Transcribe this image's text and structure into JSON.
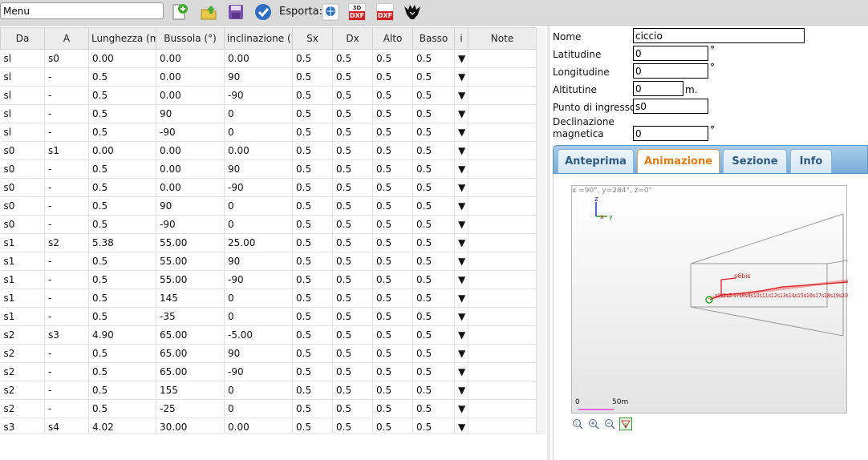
{
  "toolbar": {
    "menu_value": "Menu",
    "export_label": "Esporta:",
    "icons": [
      "new-file-icon",
      "open-folder-icon",
      "save-disk-icon",
      "check-icon",
      "kml-globe-icon",
      "dxf-3d-icon",
      "dxf-icon",
      "therion-bat-icon"
    ],
    "dxf3d_top": "3D",
    "dxf_label": "DXF"
  },
  "grid": {
    "columns": [
      "Da",
      "A",
      "Lunghezza (m)",
      "Bussola (°)",
      "inclinazione (°)",
      "Sx",
      "Dx",
      "Alto",
      "Basso",
      "i",
      "Note"
    ],
    "rows": [
      [
        "sl",
        "s0",
        "0.00",
        "0.00",
        "0.00",
        "0.5",
        "0.5",
        "0.5",
        "0.5",
        "▼",
        ""
      ],
      [
        "sl",
        "-",
        "0.5",
        "0.00",
        "90",
        "0.5",
        "0.5",
        "0.5",
        "0.5",
        "▼",
        ""
      ],
      [
        "sl",
        "-",
        "0.5",
        "0.00",
        "-90",
        "0.5",
        "0.5",
        "0.5",
        "0.5",
        "▼",
        ""
      ],
      [
        "sl",
        "-",
        "0.5",
        "90",
        "0",
        "0.5",
        "0.5",
        "0.5",
        "0.5",
        "▼",
        ""
      ],
      [
        "sl",
        "-",
        "0.5",
        "-90",
        "0",
        "0.5",
        "0.5",
        "0.5",
        "0.5",
        "▼",
        ""
      ],
      [
        "s0",
        "s1",
        "0.00",
        "0.00",
        "0.00",
        "0.5",
        "0.5",
        "0.5",
        "0.5",
        "▼",
        ""
      ],
      [
        "s0",
        "-",
        "0.5",
        "0.00",
        "90",
        "0.5",
        "0.5",
        "0.5",
        "0.5",
        "▼",
        ""
      ],
      [
        "s0",
        "-",
        "0.5",
        "0.00",
        "-90",
        "0.5",
        "0.5",
        "0.5",
        "0.5",
        "▼",
        ""
      ],
      [
        "s0",
        "-",
        "0.5",
        "90",
        "0",
        "0.5",
        "0.5",
        "0.5",
        "0.5",
        "▼",
        ""
      ],
      [
        "s0",
        "-",
        "0.5",
        "-90",
        "0",
        "0.5",
        "0.5",
        "0.5",
        "0.5",
        "▼",
        ""
      ],
      [
        "s1",
        "s2",
        "5.38",
        "55.00",
        "25.00",
        "0.5",
        "0.5",
        "0.5",
        "0.5",
        "▼",
        ""
      ],
      [
        "s1",
        "-",
        "0.5",
        "55.00",
        "90",
        "0.5",
        "0.5",
        "0.5",
        "0.5",
        "▼",
        ""
      ],
      [
        "s1",
        "-",
        "0.5",
        "55.00",
        "-90",
        "0.5",
        "0.5",
        "0.5",
        "0.5",
        "▼",
        ""
      ],
      [
        "s1",
        "-",
        "0.5",
        "145",
        "0",
        "0.5",
        "0.5",
        "0.5",
        "0.5",
        "▼",
        ""
      ],
      [
        "s1",
        "-",
        "0.5",
        "-35",
        "0",
        "0.5",
        "0.5",
        "0.5",
        "0.5",
        "▼",
        ""
      ],
      [
        "s2",
        "s3",
        "4.90",
        "65.00",
        "-5.00",
        "0.5",
        "0.5",
        "0.5",
        "0.5",
        "▼",
        ""
      ],
      [
        "s2",
        "-",
        "0.5",
        "65.00",
        "90",
        "0.5",
        "0.5",
        "0.5",
        "0.5",
        "▼",
        ""
      ],
      [
        "s2",
        "-",
        "0.5",
        "65.00",
        "-90",
        "0.5",
        "0.5",
        "0.5",
        "0.5",
        "▼",
        ""
      ],
      [
        "s2",
        "-",
        "0.5",
        "155",
        "0",
        "0.5",
        "0.5",
        "0.5",
        "0.5",
        "▼",
        ""
      ],
      [
        "s2",
        "-",
        "0.5",
        "-25",
        "0",
        "0.5",
        "0.5",
        "0.5",
        "0.5",
        "▼",
        ""
      ],
      [
        "s3",
        "s4",
        "4.02",
        "30.00",
        "0.00",
        "0.5",
        "0.5",
        "0.5",
        "0.5",
        "▼",
        ""
      ]
    ]
  },
  "props": {
    "name_label": "Nome",
    "name_value": "ciccio",
    "lat_label": "Latitudine",
    "lat_value": "0",
    "lon_label": "Longitudine",
    "lon_value": "0",
    "alt_label": "Altitutine",
    "alt_value": "0",
    "alt_unit": "m.",
    "entry_label": "Punto di ingresso",
    "entry_value": "s0",
    "decl_label_1": "Declinazione",
    "decl_label_2": "magnetica",
    "decl_value": "0",
    "degree": "°"
  },
  "tabs": [
    {
      "label": "Anteprima",
      "active": false
    },
    {
      "label": "Animazione",
      "active": true
    },
    {
      "label": "Sezione",
      "active": false
    },
    {
      "label": "Info",
      "active": false
    }
  ],
  "viewer": {
    "coords": "x =90°, y=284°, z=0°",
    "axis_z": "z",
    "axis_x": "x",
    "axis_y": "y",
    "station_label": "s6bis",
    "station_chain": "s0s2s5  s7s8s9s10s11s12s13s14s15s16s17s18s19s20",
    "scale_zero": "0",
    "scale_label": "50m",
    "colors": {
      "survey": "#e01515",
      "grid": "#9a9a9a",
      "scale": "#e040e0",
      "entrance": "#20b020"
    }
  },
  "zoom_controls": [
    "zoom-reset-icon",
    "zoom-in-icon",
    "zoom-out-icon",
    "view-3d-icon"
  ]
}
